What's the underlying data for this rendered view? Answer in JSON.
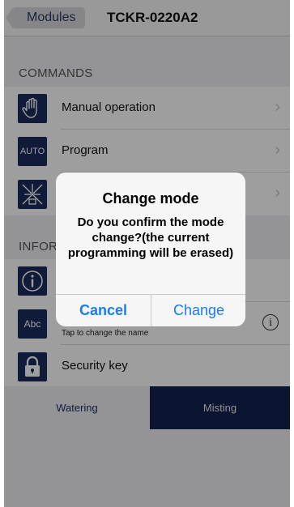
{
  "navbar": {
    "back_label": "Modules",
    "title": "TCKR-0220A2"
  },
  "commands": {
    "header": "COMMANDS",
    "items": [
      {
        "label": "Manual operation",
        "icon": "hand-icon"
      },
      {
        "label": "Program",
        "icon": "auto-icon",
        "icon_text": "AUTO"
      },
      {
        "label": "",
        "icon": "spray-icon"
      }
    ]
  },
  "info": {
    "header": "INFOR",
    "items": [
      {
        "label": "",
        "icon": "info-icon",
        "icon_text": "i"
      },
      {
        "label": "",
        "subtext": "Tap to change the name",
        "icon": "abc-icon",
        "icon_text": "Abc",
        "right_icon_text": "i"
      },
      {
        "label": "Security key",
        "icon": "lock-icon"
      }
    ]
  },
  "tabs": {
    "watering": "Watering",
    "misting": "Misting",
    "selected": "Misting"
  },
  "alert": {
    "title": "Change mode",
    "message": "Do you confirm the mode change?(the current programming will be erased)",
    "cancel": "Cancel",
    "confirm": "Change"
  },
  "colors": {
    "accent": "#1a7cf0",
    "navy": "#1a2a5c",
    "tab_selected": "#12214f"
  }
}
